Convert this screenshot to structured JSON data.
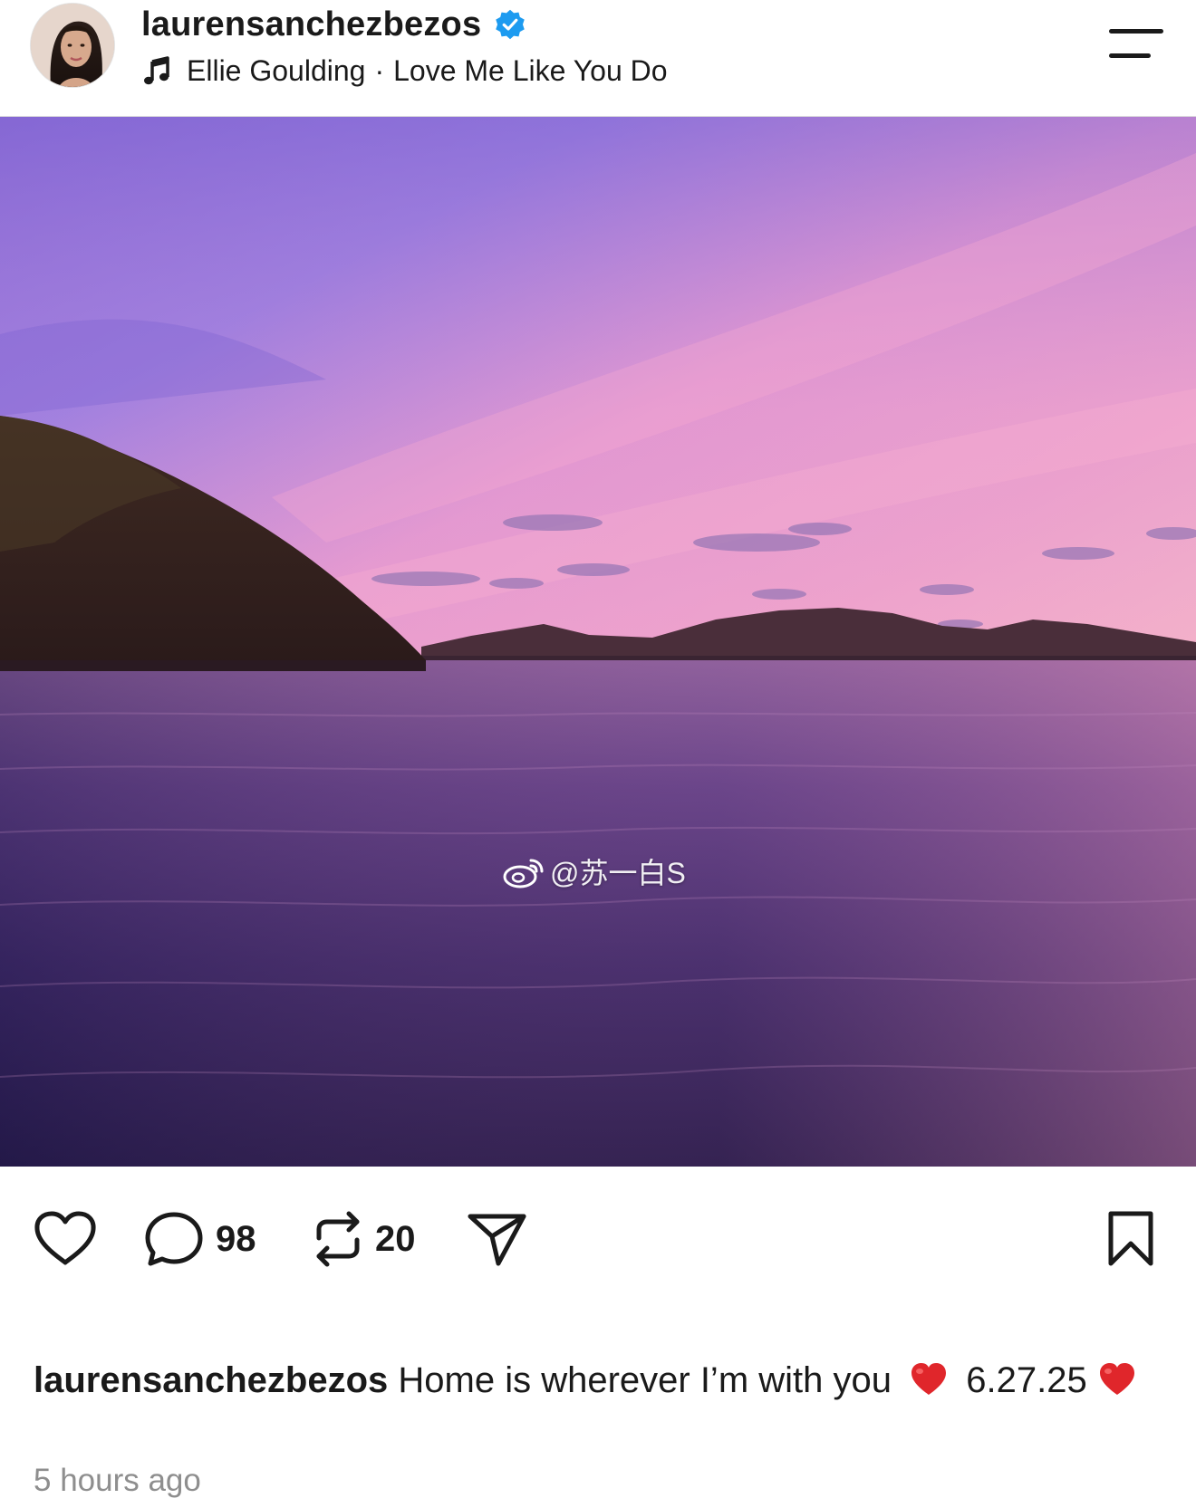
{
  "header": {
    "username": "laurensanchezbezos",
    "verified": true,
    "music_artist": "Ellie Goulding",
    "music_separator": "·",
    "music_title": "Love Me Like You Do"
  },
  "media": {
    "watermark": "@苏一白S"
  },
  "actions": {
    "comments_count": "98",
    "reposts_count": "20"
  },
  "caption": {
    "username": "laurensanchezbezos",
    "text": "Home is wherever I’m with you",
    "date": "6.27.25"
  },
  "timestamp": "5 hours ago",
  "colors": {
    "verified_blue": "#1d9bf0",
    "heart_red": "#e0262b",
    "muted_gray": "#8e8e8e"
  },
  "icons": {
    "music": "music-note-icon",
    "menu": "menu-icon",
    "sound": "speaker-icon",
    "like": "heart-icon",
    "comment": "comment-bubble-icon",
    "repost": "repost-icon",
    "share": "send-icon",
    "save": "bookmark-icon",
    "watermark": "weibo-icon"
  }
}
